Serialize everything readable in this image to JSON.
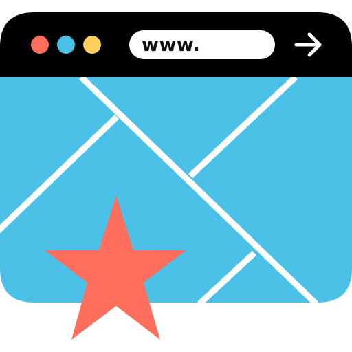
{
  "browser": {
    "address_bar": {
      "text": "www."
    },
    "window_controls": [
      {
        "name": "close",
        "color": "#FF6F5E"
      },
      {
        "name": "minimize",
        "color": "#4BC1E8"
      },
      {
        "name": "maximize",
        "color": "#FFD05B"
      }
    ],
    "navigate_icon": "arrow-right-icon"
  },
  "content": {
    "type": "map",
    "background_color": "#4BC1E8",
    "road_color": "#FFFFFF",
    "marker": {
      "icon": "star-icon",
      "color": "#FF6F5E"
    }
  },
  "colors": {
    "toolbar": "#000000",
    "address_bar_bg": "#FFFFFF"
  }
}
